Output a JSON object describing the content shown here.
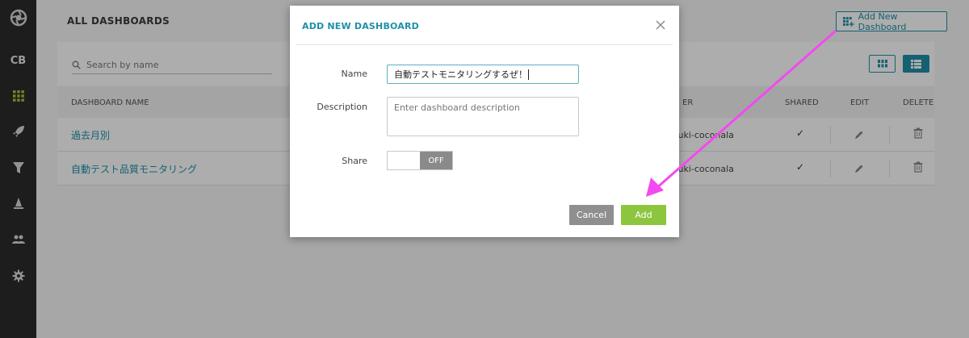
{
  "app": {
    "brand_label": "CB"
  },
  "sidebar": {
    "items": [
      {
        "name": "logo",
        "icon": "aperture-logo-icon"
      },
      {
        "name": "cb",
        "label": "CB"
      },
      {
        "name": "dashboards",
        "icon": "grid-icon",
        "active": true
      },
      {
        "name": "launch",
        "icon": "rocket-icon"
      },
      {
        "name": "filter",
        "icon": "filter-icon"
      },
      {
        "name": "cone",
        "icon": "cone-icon"
      },
      {
        "name": "users",
        "icon": "users-icon"
      },
      {
        "name": "settings",
        "icon": "gear-icon"
      }
    ]
  },
  "page": {
    "title": "ALL DASHBOARDS",
    "add_button_label": "Add New Dashboard",
    "search_placeholder": "Search by name"
  },
  "table": {
    "headers": {
      "name": "DASHBOARD NAME",
      "owner": "ER",
      "shared": "SHARED",
      "edit": "EDIT",
      "delete": "DELETE"
    },
    "rows": [
      {
        "name": "過去月別",
        "owner": "suzuki-coconala",
        "shared": "✓"
      },
      {
        "name": "自動テスト品質モニタリング",
        "owner": "suzuki-coconala",
        "shared": "✓"
      }
    ]
  },
  "modal": {
    "title": "ADD NEW DASHBOARD",
    "name_label": "Name",
    "name_value": "自動テストモニタリングするぜ！",
    "description_label": "Description",
    "description_placeholder": "Enter dashboard description",
    "share_label": "Share",
    "share_state": "OFF",
    "cancel_label": "Cancel",
    "add_label": "Add"
  },
  "colors": {
    "accent": "#1f8fa8",
    "add_button": "#8cc63f",
    "annotation_arrow": "#f24af0"
  }
}
